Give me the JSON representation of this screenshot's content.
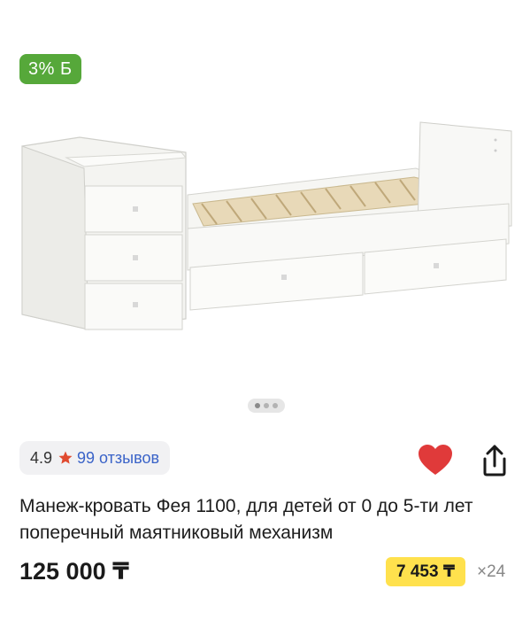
{
  "badge": {
    "cashback_label": "3% Б",
    "color": "#56a83a"
  },
  "gallery": {
    "image_icon": "baby-crib-bed-image",
    "dots_count": 3,
    "active_dot": 1
  },
  "rating": {
    "value": "4.9",
    "star_icon": "star-icon",
    "star_color": "#e04a2f",
    "reviews_label": "99 отзывов"
  },
  "actions": {
    "favorite_icon": "heart-icon",
    "favorite_color": "#e03a3a",
    "share_icon": "share-icon"
  },
  "product": {
    "title": "Манеж-кровать Фея 1100, для детей от 0 до 5-ти лет поперечный маятниковый механизм",
    "price": "125 000 ₸",
    "installment_price": "7 453 ₸",
    "installment_months": "×24",
    "installment_color": "#ffe14d"
  }
}
